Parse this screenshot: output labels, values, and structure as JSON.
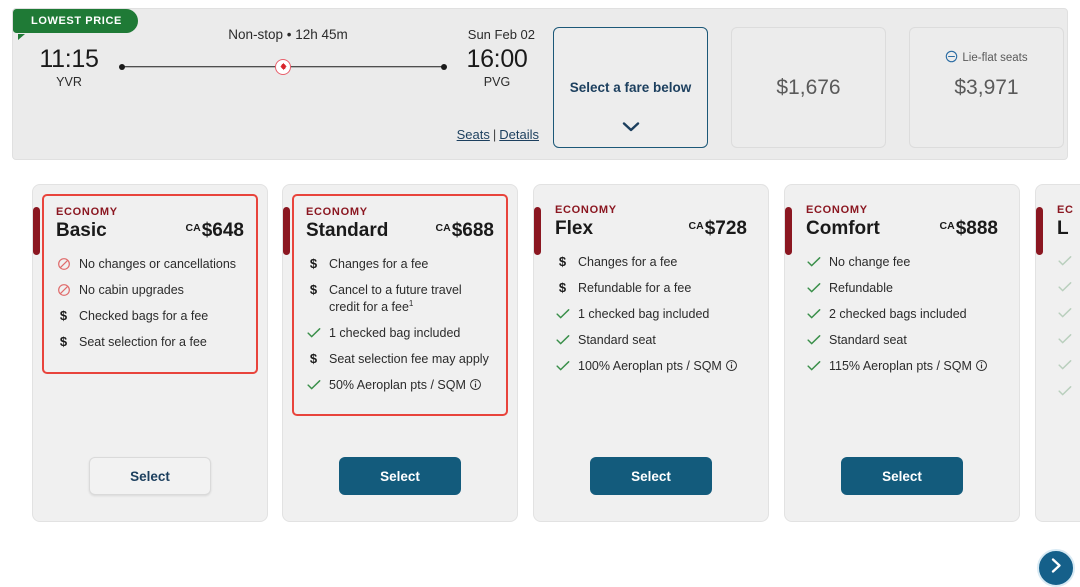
{
  "badge": {
    "label": "LOWEST PRICE",
    "color": "#1f7a36"
  },
  "flight": {
    "stops_duration": "Non-stop • 12h 45m",
    "arrival_date": "Sun Feb 02",
    "depart_time": "11:15",
    "depart_airport": "YVR",
    "arrive_time": "16:00",
    "arrive_airport": "PVG",
    "airline_icon": "maple-leaf-icon",
    "links": {
      "seats": "Seats",
      "separator": "|",
      "details": "Details"
    }
  },
  "cabins": [
    {
      "id": "economy",
      "label": "Select a fare below",
      "selected": true,
      "chevron": "chevron-down-icon"
    },
    {
      "id": "premium",
      "price": "$1,676",
      "selected": false
    },
    {
      "id": "business",
      "price": "$3,971",
      "selected": false,
      "amenity": "Lie-flat seats",
      "amenity_icon": "lie-flat-seat-icon"
    }
  ],
  "fares": [
    {
      "cabin": "ECONOMY",
      "name": "Basic",
      "currency": "CA",
      "price": "$648",
      "highlight": true,
      "features": [
        {
          "icon": "prohibited-icon",
          "text": "No changes or cancellations"
        },
        {
          "icon": "prohibited-icon",
          "text": "No cabin upgrades"
        },
        {
          "icon": "dollar-icon",
          "text": "Checked bags for a fee"
        },
        {
          "icon": "dollar-icon",
          "text": "Seat selection for a fee"
        }
      ],
      "button": {
        "label": "Select",
        "style": "ghost"
      }
    },
    {
      "cabin": "ECONOMY",
      "name": "Standard",
      "currency": "CA",
      "price": "$688",
      "highlight": true,
      "features": [
        {
          "icon": "dollar-icon",
          "text": "Changes for a fee"
        },
        {
          "icon": "dollar-icon",
          "text": "Cancel to a future travel credit for a fee",
          "sup": "1"
        },
        {
          "icon": "check-icon",
          "text": "1 checked bag included"
        },
        {
          "icon": "dollar-icon",
          "text": "Seat selection fee may apply"
        },
        {
          "icon": "check-icon",
          "text": "50% Aeroplan pts / SQM",
          "info": "info-icon"
        }
      ],
      "button": {
        "label": "Select",
        "style": "solid"
      }
    },
    {
      "cabin": "ECONOMY",
      "name": "Flex",
      "currency": "CA",
      "price": "$728",
      "highlight": false,
      "features": [
        {
          "icon": "dollar-icon",
          "text": "Changes for a fee"
        },
        {
          "icon": "dollar-icon",
          "text": "Refundable for a fee"
        },
        {
          "icon": "check-icon",
          "text": "1 checked bag included"
        },
        {
          "icon": "check-icon",
          "text": "Standard seat"
        },
        {
          "icon": "check-icon",
          "text": "100% Aeroplan pts / SQM",
          "info": "info-icon"
        }
      ],
      "button": {
        "label": "Select",
        "style": "solid"
      }
    },
    {
      "cabin": "ECONOMY",
      "name": "Comfort",
      "currency": "CA",
      "price": "$888",
      "highlight": false,
      "features": [
        {
          "icon": "check-icon",
          "text": "No change fee"
        },
        {
          "icon": "check-icon",
          "text": "Refundable"
        },
        {
          "icon": "check-icon",
          "text": "2 checked bags included"
        },
        {
          "icon": "check-icon",
          "text": "Standard seat"
        },
        {
          "icon": "check-icon",
          "text": "115% Aeroplan pts / SQM",
          "info": "info-icon"
        }
      ],
      "button": {
        "label": "Select",
        "style": "solid"
      }
    },
    {
      "cabin": "EC",
      "name": "L",
      "currency": "",
      "price": "",
      "highlight": false,
      "partial": true,
      "features": [],
      "button": {
        "label": "",
        "style": "solid"
      }
    }
  ],
  "carousel": {
    "next_icon": "chevron-right-icon"
  },
  "colors": {
    "accent_red": "#8b1721",
    "highlight_red": "#e8443c",
    "button_blue": "#135b7c",
    "link_blue": "#1c3f5e",
    "green": "#1f7a36",
    "check_green": "#3a8f4a"
  }
}
